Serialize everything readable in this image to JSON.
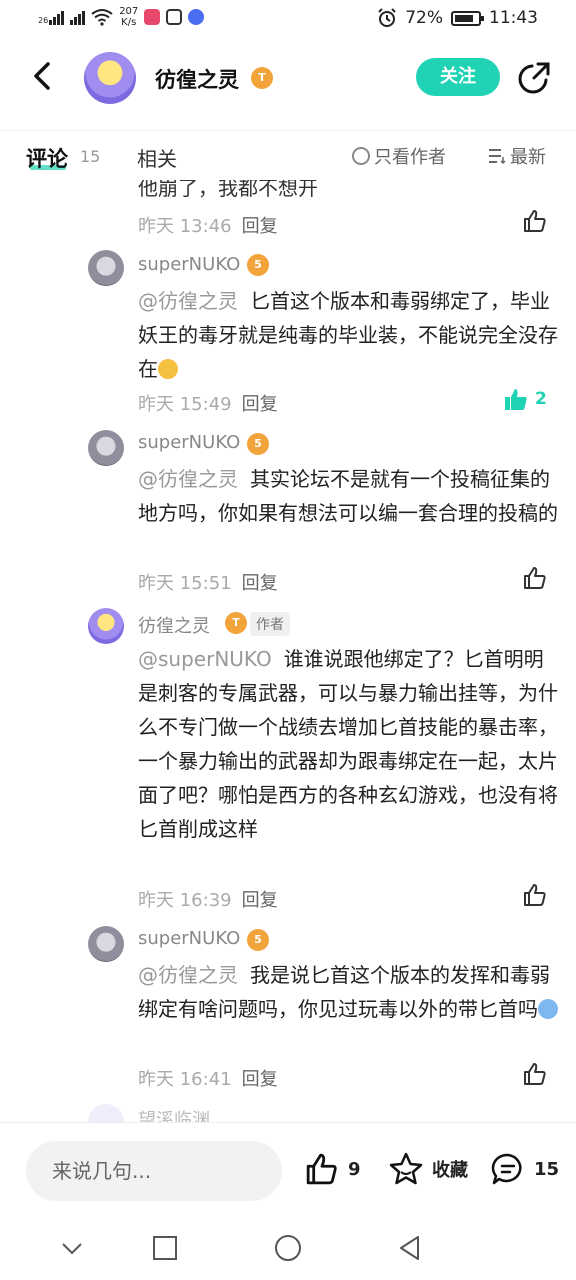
{
  "status": {
    "network": "26",
    "speed_value": "207",
    "speed_unit": "K/s",
    "battery": "72%",
    "time": "11:43"
  },
  "header": {
    "title": "彷徨之灵",
    "level": "T4",
    "follow_label": "关注"
  },
  "tabs": {
    "comments_label": "评论",
    "comments_count": "15",
    "related_label": "相关",
    "only_author_label": "只看作者",
    "sort_label": "最新"
  },
  "partial_comment": {
    "text": "他崩了，我都不想开",
    "time": "昨天 13:46",
    "reply": "回复"
  },
  "comments": [
    {
      "user": "superNUKO",
      "level": "5",
      "mention": "@彷徨之灵",
      "text": "匕首这个版本和毒弱绑定了，毕业妖王的毒牙就是纯毒的毕业装，不能说完全没存在",
      "time": "昨天 15:49",
      "reply": "回复",
      "likes": "2"
    },
    {
      "user": "superNUKO",
      "level": "5",
      "mention": "@彷徨之灵",
      "text": "其实论坛不是就有一个投稿征集的地方吗，你如果有想法可以编一套合理的投稿的",
      "time": "昨天 15:51",
      "reply": "回复"
    },
    {
      "user": "彷徨之灵",
      "level": "T4",
      "tag": "作者",
      "mention": "@superNUKO",
      "text": "谁谁说跟他绑定了？匕首明明是刺客的专属武器，可以与暴力输出挂等，为什么不专门做一个战绩去增加匕首技能的暴击率，一个暴力输出的武器却为跟毒绑定在一起，太片面了吧？哪怕是西方的各种玄幻游戏，也没有将匕首削成这样",
      "time": "昨天 16:39",
      "reply": "回复"
    },
    {
      "user": "superNUKO",
      "level": "5",
      "mention": "@彷徨之灵",
      "text": "我是说匕首这个版本的发挥和毒弱绑定有啥问题吗，你见过玩毒以外的带匕首吗",
      "time": "昨天 16:41",
      "reply": "回复"
    }
  ],
  "next_user": "望溪临渊",
  "bottom": {
    "input_placeholder": "来说几句...",
    "like_count": "9",
    "collect_label": "收藏",
    "comment_count": "15"
  },
  "colors": {
    "accent": "#1fd3b4",
    "level_badge": "#f2a33a"
  }
}
